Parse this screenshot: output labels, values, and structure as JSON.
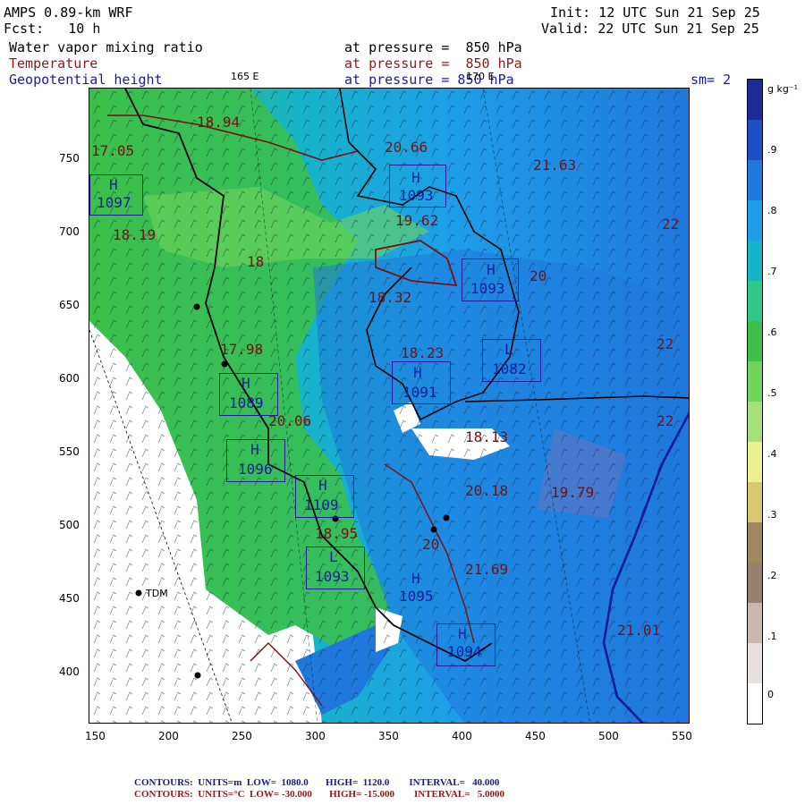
{
  "header": {
    "model": "AMPS 0.89-km WRF",
    "forecast": "Fcst:   10 h",
    "init": "Init: 12 UTC Sun 21 Sep 25",
    "valid": "Valid: 22 UTC Sun 21 Sep 25",
    "fields": [
      {
        "name": "Water vapor mixing ratio",
        "level": "at pressure =  850 hPa",
        "color": "#000000"
      },
      {
        "name": "Temperature",
        "level": "at pressure =  850 hPa",
        "color": "#8b1a1a"
      },
      {
        "name": "Geopotential height",
        "level": "at pressure = 850 hPa",
        "color": "#1a1aa0"
      }
    ],
    "smoothing": "sm= 2",
    "lon_label_left": "165 E",
    "lon_label_right": "170 E"
  },
  "axes": {
    "x_ticks": [
      "150",
      "200",
      "250",
      "300",
      "350",
      "400",
      "450",
      "500",
      "550"
    ],
    "y_ticks": [
      "750",
      "700",
      "650",
      "600",
      "550",
      "500",
      "450",
      "400"
    ]
  },
  "colorbar": {
    "unit": "g kg⁻¹",
    "labels": [
      ".9",
      ".8",
      ".7",
      ".6",
      ".5",
      ".4",
      ".3",
      ".2",
      ".1",
      "0"
    ],
    "colors": [
      "#1e2a9a",
      "#1f4fc4",
      "#1f78dc",
      "#1e9ee8",
      "#16b4c8",
      "#2ec88a",
      "#3cc04a",
      "#6ed45a",
      "#a4e07a",
      "#e8f090",
      "#d8c870",
      "#a08860",
      "#9a8070",
      "#c8b8b0",
      "#e8e0e0",
      "#ffffff"
    ]
  },
  "stations": [
    {
      "label": "TDM"
    }
  ],
  "highs": [
    {
      "label": "H",
      "value": "1097"
    },
    {
      "label": "H",
      "value": "1093"
    },
    {
      "label": "H",
      "value": "1093"
    },
    {
      "label": "L",
      "value": "1082"
    },
    {
      "label": "H",
      "value": "1091"
    },
    {
      "label": "H",
      "value": "1089"
    },
    {
      "label": "H",
      "value": "1096"
    },
    {
      "label": "H",
      "value": "1109"
    },
    {
      "label": "L",
      "value": "1093"
    },
    {
      "label": "H",
      "value": "1095"
    },
    {
      "label": "H",
      "value": "1094"
    }
  ],
  "temps": [
    "18.94",
    "17.05",
    "18.19",
    "18",
    "20.66",
    "19.62",
    "21.63",
    "22",
    "18.32",
    "20",
    "18.23",
    "22",
    "17.98",
    "20.06",
    "22",
    "18.13",
    "20.18",
    "19.79",
    "18.95",
    "20",
    "21.69",
    "21.01"
  ],
  "footer": {
    "line1": "CONTOURS:  UNITS=m  LOW=  1080.0       HIGH=  1120.0        INTERVAL=   40.000",
    "line2": "CONTOURS:  UNITS=°C  LOW= -30.000       HIGH= -15.000        INTERVAL=   5.0000",
    "color1": "#1a1a80",
    "color2": "#8b1a1a"
  }
}
